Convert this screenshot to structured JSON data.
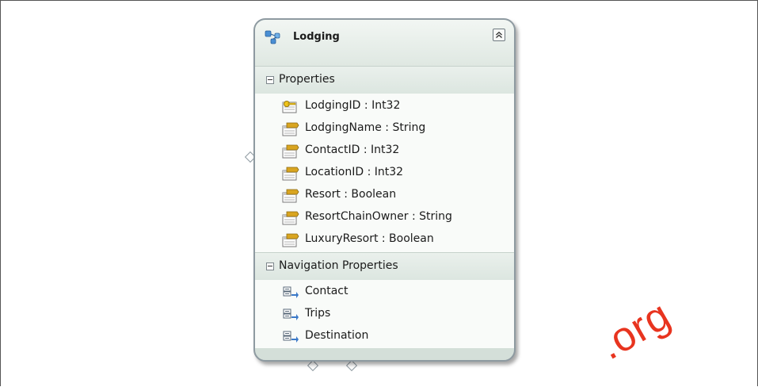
{
  "entity": {
    "title": "Lodging",
    "icon": "entity-icon",
    "collapse_icon": "collapse-chevron-icon"
  },
  "properties": {
    "title": "Properties",
    "items": [
      {
        "label": "LodgingID : Int32",
        "icon": "key-property-icon"
      },
      {
        "label": "LodgingName : String",
        "icon": "property-icon"
      },
      {
        "label": "ContactID : Int32",
        "icon": "property-icon"
      },
      {
        "label": "LocationID : Int32",
        "icon": "property-icon"
      },
      {
        "label": "Resort : Boolean",
        "icon": "property-icon"
      },
      {
        "label": "ResortChainOwner : String",
        "icon": "property-icon"
      },
      {
        "label": "LuxuryResort : Boolean",
        "icon": "property-icon"
      }
    ]
  },
  "navigation": {
    "title": "Navigation Properties",
    "items": [
      {
        "label": "Contact",
        "icon": "navigation-property-icon"
      },
      {
        "label": "Trips",
        "icon": "navigation-property-icon"
      },
      {
        "label": "Destination",
        "icon": "navigation-property-icon"
      }
    ]
  },
  "watermark": ".org",
  "colors": {
    "header": "#e8efea",
    "body": "#f9fbf9",
    "border": "#8e9aa1",
    "watermark": "#e8341f"
  }
}
